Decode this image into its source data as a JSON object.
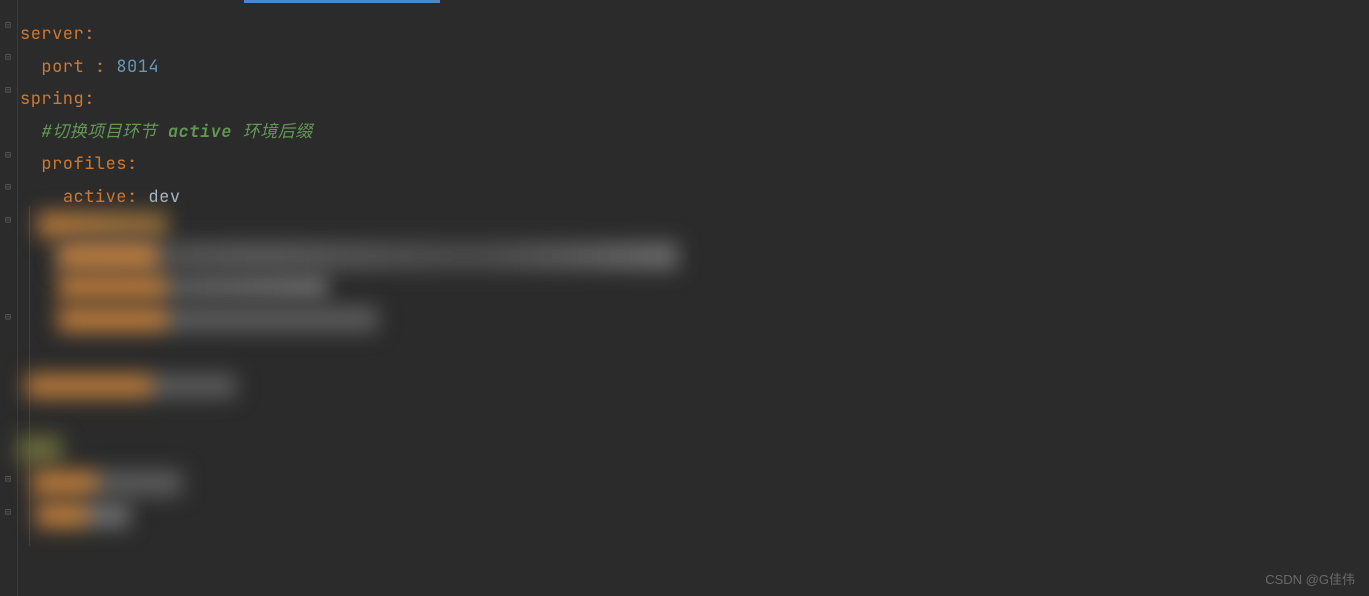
{
  "code": {
    "line1_key": "server",
    "line1_colon": ":",
    "line2_indent": "  ",
    "line2_key": "port",
    "line2_sep": " : ",
    "line2_value": "8014",
    "line3_key": "spring",
    "line3_colon": ":",
    "line4_indent": "  ",
    "line4_comment_prefix": "#切换项目环节 ",
    "line4_comment_bold": "active",
    "line4_comment_suffix": " 环境后缀",
    "line5_indent": "  ",
    "line5_key": "profiles",
    "line5_colon": ":",
    "line6_indent": "    ",
    "line6_key": "active",
    "line6_sep": ": ",
    "line6_value": "dev"
  },
  "watermark": "CSDN @G佳伟",
  "colors": {
    "background": "#2b2b2b",
    "keyword": "#cc7832",
    "number": "#6897bb",
    "comment": "#629755",
    "text": "#a9b7c6",
    "tab_highlight": "#4a88c7"
  }
}
